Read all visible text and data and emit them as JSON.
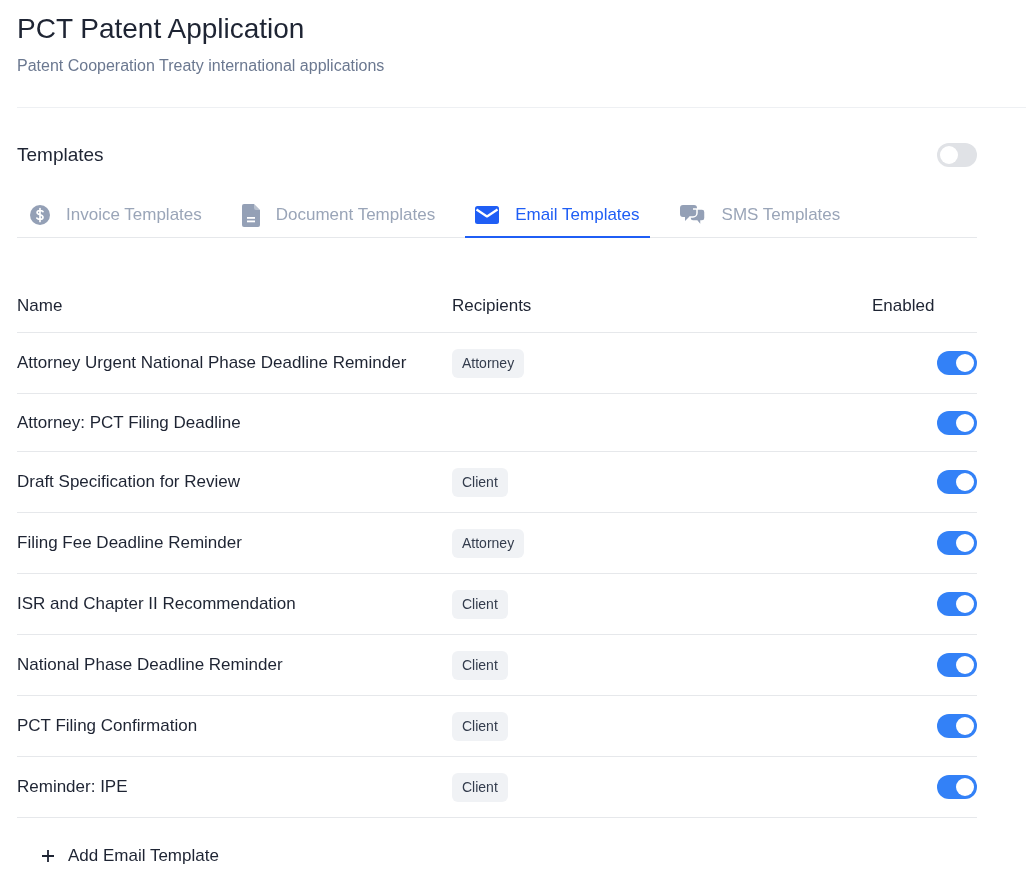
{
  "header": {
    "title": "PCT Patent Application",
    "subtitle": "Patent Cooperation Treaty international applications"
  },
  "templates": {
    "label": "Templates",
    "on": false
  },
  "tabs": [
    {
      "label": "Invoice Templates",
      "selected": false
    },
    {
      "label": "Document Templates",
      "selected": false
    },
    {
      "label": "Email Templates",
      "selected": true
    },
    {
      "label": "SMS Templates",
      "selected": false
    }
  ],
  "table": {
    "columns": [
      "Name",
      "Recipients",
      "Enabled"
    ],
    "rows": [
      {
        "name": "Attorney Urgent National Phase Deadline Reminder",
        "recipients": [
          "Attorney"
        ],
        "enabled": true
      },
      {
        "name": "Attorney: PCT Filing Deadline",
        "enabled": true
      },
      {
        "name": "Draft Specification for Review",
        "recipients": [
          "Client"
        ],
        "enabled": true
      },
      {
        "name": "Filing Fee Deadline Reminder",
        "recipients": [
          "Attorney"
        ],
        "enabled": true
      },
      {
        "name": "ISR and Chapter II Recommendation",
        "recipients": [
          "Client"
        ],
        "enabled": true
      },
      {
        "name": "National Phase Deadline Reminder",
        "recipients": [
          "Client"
        ],
        "enabled": true
      },
      {
        "name": "PCT Filing Confirmation",
        "recipients": [
          "Client"
        ],
        "enabled": true
      },
      {
        "name": "Reminder: IPE",
        "recipients": [
          "Client"
        ],
        "enabled": true
      }
    ]
  },
  "add_button": {
    "label": "Add Email Template"
  }
}
